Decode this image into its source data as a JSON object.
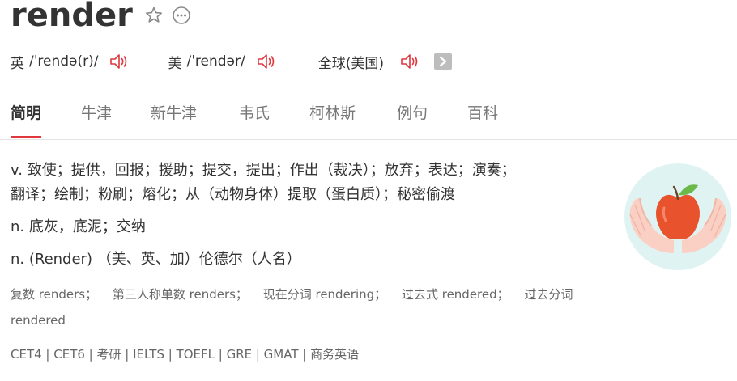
{
  "word": {
    "title": "render"
  },
  "pronunciations": [
    {
      "region": "英",
      "ipa": "/ˈrendə(r)/"
    },
    {
      "region": "美",
      "ipa": "/ˈrendər/"
    },
    {
      "region": "全球(美国)",
      "ipa": ""
    }
  ],
  "tabs": [
    "简明",
    "牛津",
    "新牛津",
    "韦氏",
    "柯林斯",
    "例句",
    "百科"
  ],
  "active_tab": "简明",
  "definitions": [
    {
      "text_1": "v. 致使；提供，回报；援助；提交，提出；作出（裁决）；放弃；表达；演奏；",
      "text_2": "翻译；绘制；粉刷；熔化；从（动物身体）提取（蛋白质）；秘密偷渡"
    },
    {
      "text_1": "n. 底灰，底泥；交纳"
    },
    {
      "text_1": "n. (Render) （美、英、加）伦德尔（人名）"
    }
  ],
  "inflections": [
    "复数 renders；",
    "第三人称单数 renders；",
    "现在分词 rendering；",
    "过去式 rendered；",
    "过去分词",
    "rendered"
  ],
  "exams": "CET4 | CET6 | 考研 | IELTS | TOEFL | GRE | GMAT | 商务英语",
  "colors": {
    "accent": "#e0373d",
    "text": "#333333",
    "muted": "#777777",
    "circle": "#dff3f3",
    "apple": "#e8522c",
    "hand": "#fbd0c4",
    "leaf": "#6ab94a"
  },
  "icons": {
    "star": "star-outline-icon",
    "more": "more-dots-icon",
    "speaker": "speaker-icon",
    "arrow": "arrow-right-icon",
    "illustration": "apple-in-hands-illustration"
  }
}
